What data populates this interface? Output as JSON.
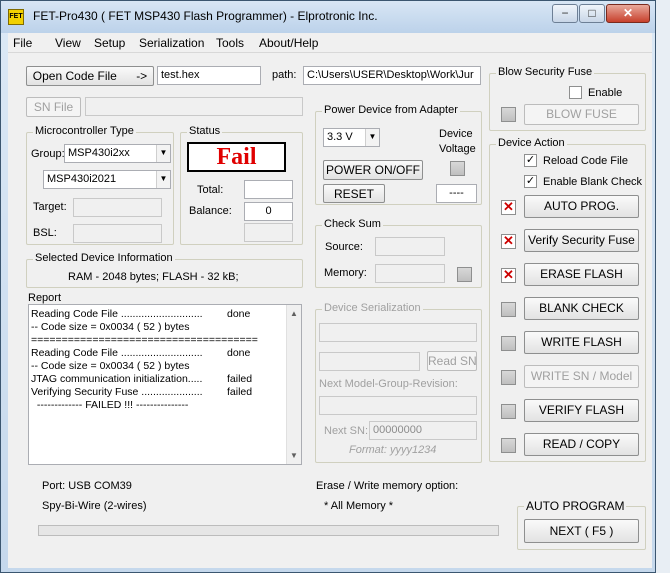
{
  "window": {
    "title": "FET-Pro430  ( FET MSP430 Flash Programmer)  -  Elprotronic Inc.",
    "icon_label": "FET"
  },
  "caption_buttons": {
    "minimize": "−",
    "maximize": "□",
    "close": "✕"
  },
  "menu": [
    "File",
    "View",
    "Setup",
    "Serialization",
    "Tools",
    "About/Help"
  ],
  "code_file": {
    "open_label": "Open Code File",
    "open_arrow": "->",
    "file_name": "test.hex",
    "path_label": "path:",
    "path_value": "C:\\Users\\USER\\Desktop\\Work\\Jur"
  },
  "sn_file": {
    "label": "SN File",
    "value": ""
  },
  "microcontroller": {
    "title": "Microcontroller Type",
    "group_label": "Group:",
    "group_value": "MSP430i2xx",
    "device_value": "MSP430i2021",
    "target_label": "Target:",
    "bsl_label": "BSL:"
  },
  "status": {
    "title": "Status",
    "result": "Fail",
    "total_label": "Total:",
    "total_value": "",
    "balance_label": "Balance:",
    "balance_value": "0"
  },
  "power": {
    "title": "Power Device from Adapter",
    "voltage": "3.3 V",
    "device_voltage_label_1": "Device",
    "device_voltage_label_2": "Voltage",
    "power_button": "POWER ON/OFF",
    "reset_button": "RESET",
    "voltage_readout": "----"
  },
  "checksum": {
    "title": "Check Sum",
    "source_label": "Source:",
    "memory_label": "Memory:"
  },
  "device_info": {
    "title": "Selected Device Information",
    "text": "RAM  -  2048 bytes;      FLASH - 32 kB;"
  },
  "report": {
    "title": "Report",
    "lines": [
      {
        "text": "Reading Code File ............................",
        "status": "done"
      },
      {
        "text": "-- Code size = 0x0034 ( 52 ) bytes",
        "status": ""
      },
      {
        "text": "=====================================",
        "status": ""
      },
      {
        "text": "Reading Code File ............................",
        "status": "done"
      },
      {
        "text": "-- Code size = 0x0034 ( 52 ) bytes",
        "status": ""
      },
      {
        "text": "JTAG communication initialization.....",
        "status": "failed"
      },
      {
        "text": "Verifying Security Fuse .....................",
        "status": "failed"
      },
      {
        "text": "  ------------- FAILED !!! ---------------",
        "status": ""
      }
    ]
  },
  "serialization": {
    "title": "Device Serialization",
    "read_sn": "Read SN",
    "model_label": "Next Model-Group-Revision:",
    "next_sn_label": "Next SN:",
    "next_sn_value": "00000000",
    "format_label": "Format: yyyy1234"
  },
  "security_fuse": {
    "title": "Blow Security Fuse",
    "enable_label": "Enable",
    "blow_button": "BLOW FUSE"
  },
  "device_action": {
    "title": "Device Action",
    "reload_label": "Reload Code File",
    "blank_check_label": "Enable Blank Check",
    "actions": [
      {
        "label": "AUTO PROG.",
        "mark": "✕"
      },
      {
        "label": "Verify Security Fuse",
        "mark": "✕"
      },
      {
        "label": "ERASE FLASH",
        "mark": "✕"
      },
      {
        "label": "BLANK CHECK",
        "mark": ""
      },
      {
        "label": "WRITE FLASH",
        "mark": ""
      },
      {
        "label": "WRITE SN / Model",
        "mark": ""
      },
      {
        "label": "VERIFY FLASH",
        "mark": ""
      },
      {
        "label": "READ / COPY",
        "mark": ""
      }
    ]
  },
  "port": {
    "label": "Port: USB COM39",
    "mode": "Spy-Bi-Wire (2-wires)"
  },
  "erase_option": {
    "label": "Erase / Write memory option:",
    "value": "* All Memory *"
  },
  "auto_program": {
    "title": "AUTO PROGRAM",
    "next_button": "NEXT  ( F5 )"
  },
  "checkbox_mark": "✓",
  "colors": {
    "fail_text": "#e00000",
    "action_mark": "#cc0000",
    "window_frame": "#c5d8ec"
  }
}
